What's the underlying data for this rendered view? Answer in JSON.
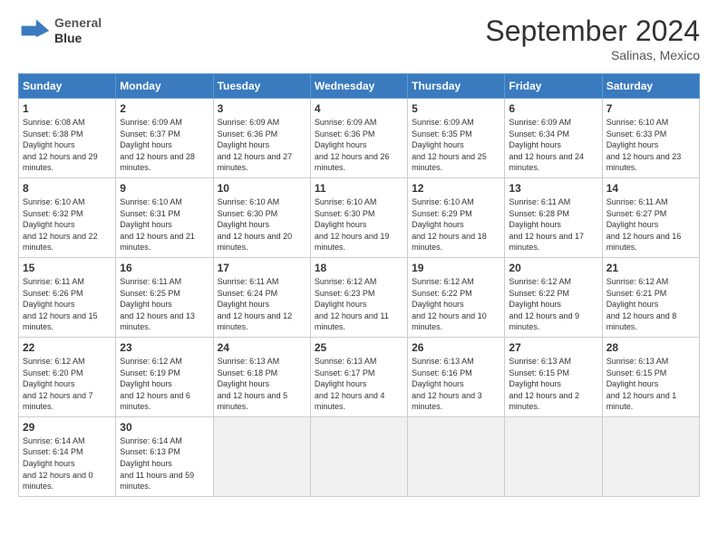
{
  "header": {
    "title": "September 2024",
    "location": "Salinas, Mexico",
    "logo_line1": "General",
    "logo_line2": "Blue"
  },
  "weekdays": [
    "Sunday",
    "Monday",
    "Tuesday",
    "Wednesday",
    "Thursday",
    "Friday",
    "Saturday"
  ],
  "weeks": [
    [
      {
        "day": "1",
        "rise": "6:08 AM",
        "set": "6:38 PM",
        "hours": "12 hours and 29 minutes."
      },
      {
        "day": "2",
        "rise": "6:09 AM",
        "set": "6:37 PM",
        "hours": "12 hours and 28 minutes."
      },
      {
        "day": "3",
        "rise": "6:09 AM",
        "set": "6:36 PM",
        "hours": "12 hours and 27 minutes."
      },
      {
        "day": "4",
        "rise": "6:09 AM",
        "set": "6:36 PM",
        "hours": "12 hours and 26 minutes."
      },
      {
        "day": "5",
        "rise": "6:09 AM",
        "set": "6:35 PM",
        "hours": "12 hours and 25 minutes."
      },
      {
        "day": "6",
        "rise": "6:09 AM",
        "set": "6:34 PM",
        "hours": "12 hours and 24 minutes."
      },
      {
        "day": "7",
        "rise": "6:10 AM",
        "set": "6:33 PM",
        "hours": "12 hours and 23 minutes."
      }
    ],
    [
      {
        "day": "8",
        "rise": "6:10 AM",
        "set": "6:32 PM",
        "hours": "12 hours and 22 minutes."
      },
      {
        "day": "9",
        "rise": "6:10 AM",
        "set": "6:31 PM",
        "hours": "12 hours and 21 minutes."
      },
      {
        "day": "10",
        "rise": "6:10 AM",
        "set": "6:30 PM",
        "hours": "12 hours and 20 minutes."
      },
      {
        "day": "11",
        "rise": "6:10 AM",
        "set": "6:30 PM",
        "hours": "12 hours and 19 minutes."
      },
      {
        "day": "12",
        "rise": "6:10 AM",
        "set": "6:29 PM",
        "hours": "12 hours and 18 minutes."
      },
      {
        "day": "13",
        "rise": "6:11 AM",
        "set": "6:28 PM",
        "hours": "12 hours and 17 minutes."
      },
      {
        "day": "14",
        "rise": "6:11 AM",
        "set": "6:27 PM",
        "hours": "12 hours and 16 minutes."
      }
    ],
    [
      {
        "day": "15",
        "rise": "6:11 AM",
        "set": "6:26 PM",
        "hours": "12 hours and 15 minutes."
      },
      {
        "day": "16",
        "rise": "6:11 AM",
        "set": "6:25 PM",
        "hours": "12 hours and 13 minutes."
      },
      {
        "day": "17",
        "rise": "6:11 AM",
        "set": "6:24 PM",
        "hours": "12 hours and 12 minutes."
      },
      {
        "day": "18",
        "rise": "6:12 AM",
        "set": "6:23 PM",
        "hours": "12 hours and 11 minutes."
      },
      {
        "day": "19",
        "rise": "6:12 AM",
        "set": "6:22 PM",
        "hours": "12 hours and 10 minutes."
      },
      {
        "day": "20",
        "rise": "6:12 AM",
        "set": "6:22 PM",
        "hours": "12 hours and 9 minutes."
      },
      {
        "day": "21",
        "rise": "6:12 AM",
        "set": "6:21 PM",
        "hours": "12 hours and 8 minutes."
      }
    ],
    [
      {
        "day": "22",
        "rise": "6:12 AM",
        "set": "6:20 PM",
        "hours": "12 hours and 7 minutes."
      },
      {
        "day": "23",
        "rise": "6:12 AM",
        "set": "6:19 PM",
        "hours": "12 hours and 6 minutes."
      },
      {
        "day": "24",
        "rise": "6:13 AM",
        "set": "6:18 PM",
        "hours": "12 hours and 5 minutes."
      },
      {
        "day": "25",
        "rise": "6:13 AM",
        "set": "6:17 PM",
        "hours": "12 hours and 4 minutes."
      },
      {
        "day": "26",
        "rise": "6:13 AM",
        "set": "6:16 PM",
        "hours": "12 hours and 3 minutes."
      },
      {
        "day": "27",
        "rise": "6:13 AM",
        "set": "6:15 PM",
        "hours": "12 hours and 2 minutes."
      },
      {
        "day": "28",
        "rise": "6:13 AM",
        "set": "6:15 PM",
        "hours": "12 hours and 1 minute."
      }
    ],
    [
      {
        "day": "29",
        "rise": "6:14 AM",
        "set": "6:14 PM",
        "hours": "12 hours and 0 minutes."
      },
      {
        "day": "30",
        "rise": "6:14 AM",
        "set": "6:13 PM",
        "hours": "11 hours and 59 minutes."
      },
      null,
      null,
      null,
      null,
      null
    ]
  ]
}
